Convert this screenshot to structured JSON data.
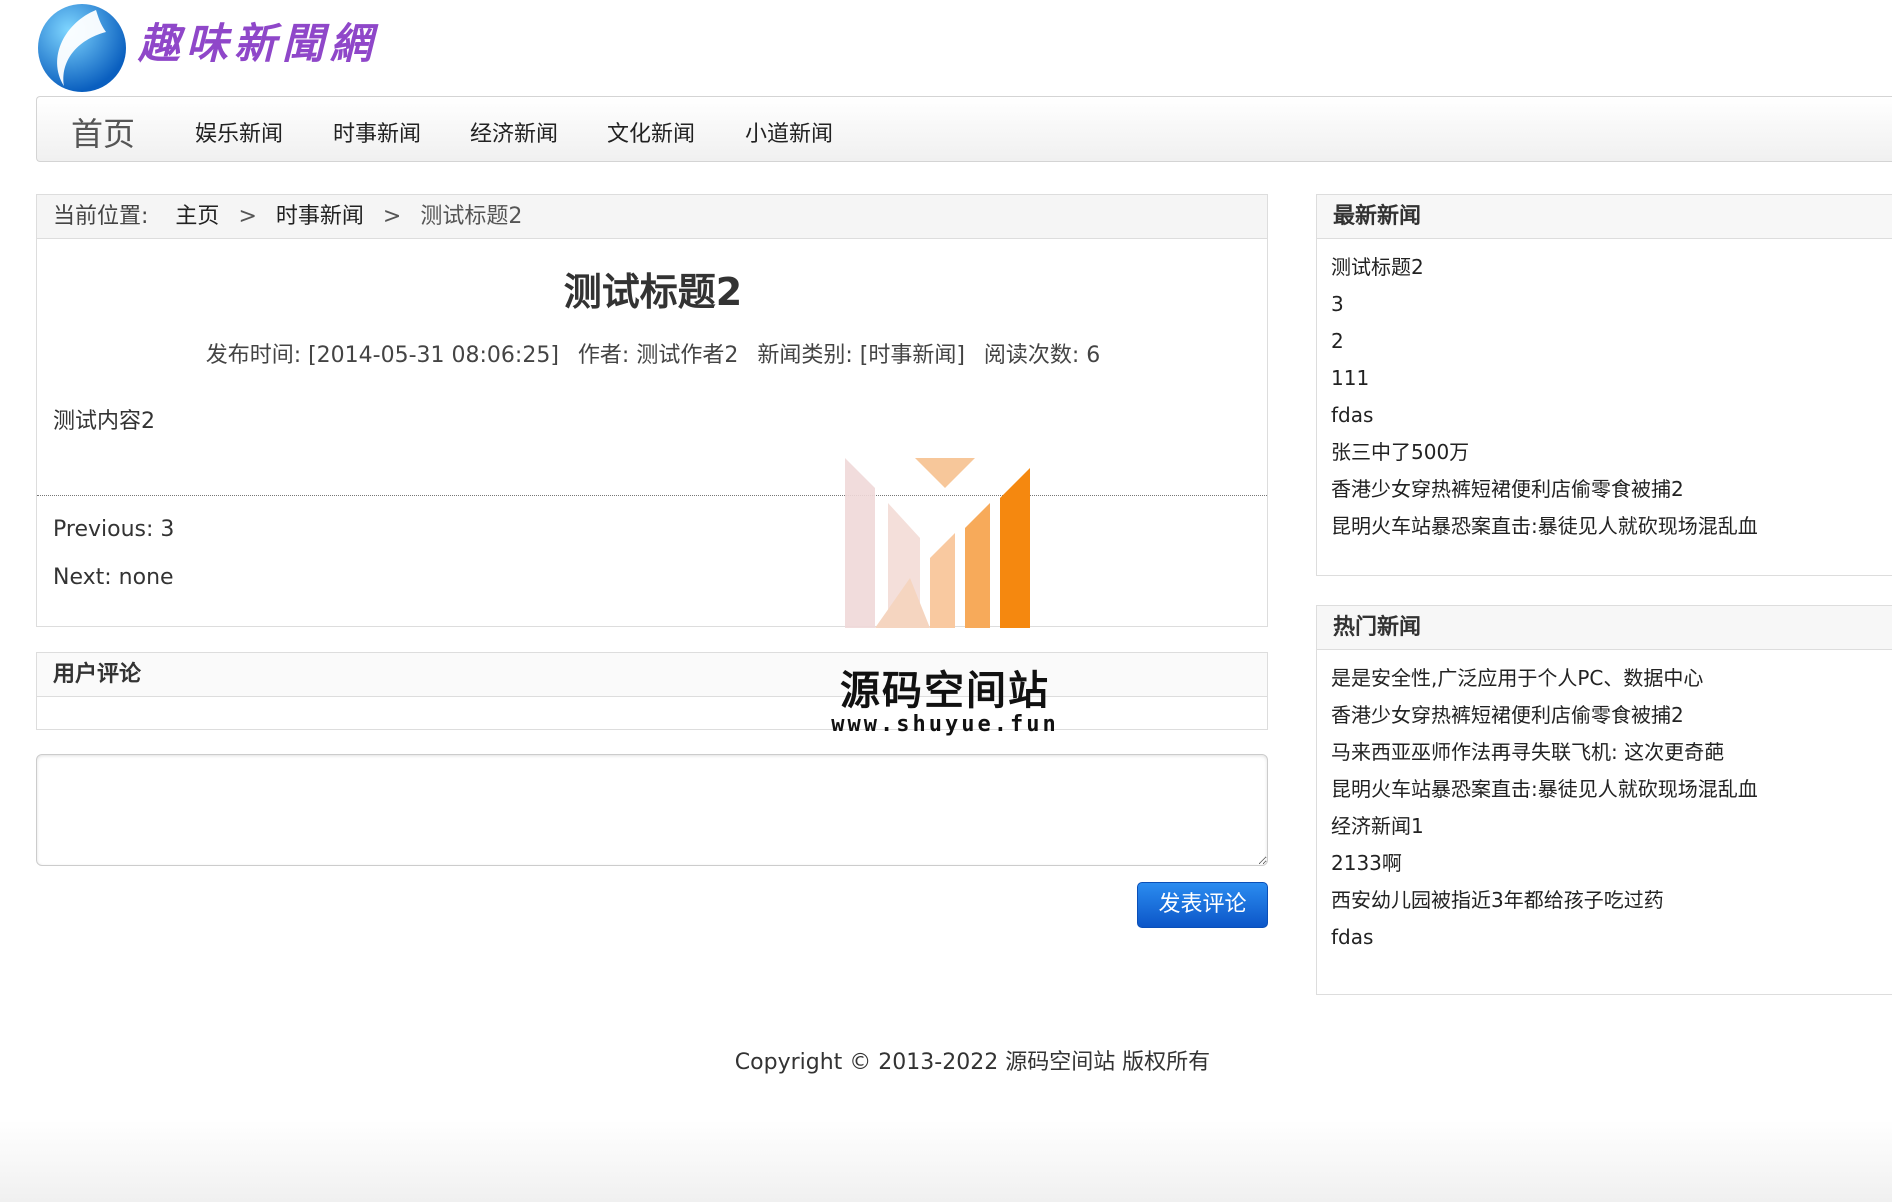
{
  "header": {
    "site_name": "趣味新聞網"
  },
  "nav": {
    "home": "首页",
    "items": [
      {
        "label": "娱乐新闻"
      },
      {
        "label": "时事新闻"
      },
      {
        "label": "经济新闻"
      },
      {
        "label": "文化新闻"
      },
      {
        "label": "小道新闻"
      }
    ]
  },
  "breadcrumb": {
    "label": "当前位置:",
    "home": "主页",
    "sep": ">",
    "category": "时事新闻",
    "current": "测试标题2"
  },
  "article": {
    "title": "测试标题2",
    "publish_time": "发布时间: [2014-05-31 08:06:25]",
    "author": "作者: 测试作者2",
    "category": "新闻类别: [时事新闻]",
    "views": "阅读次数: 6",
    "content": "测试内容2",
    "prev_label": "Previous:",
    "prev_value": "3",
    "next_label": "Next:",
    "next_value": "none"
  },
  "comments": {
    "title": "用户评论",
    "input_value": "",
    "submit_label": "发表评论"
  },
  "latest_news": {
    "title": "最新新闻",
    "items": [
      "测试标题2",
      "3",
      "2",
      "111",
      "fdas",
      "张三中了500万",
      "香港少女穿热裤短裙便利店偷零食被捕2",
      "昆明火车站暴恐案直击:暴徒见人就砍现场混乱血"
    ]
  },
  "hot_news": {
    "title": "热门新闻",
    "items": [
      "是是安全性,广泛应用于个人PC、数据中心",
      "香港少女穿热裤短裙便利店偷零食被捕2",
      "马来西亚巫师作法再寻失联飞机: 这次更奇葩",
      "昆明火车站暴恐案直击:暴徒见人就砍现场混乱血",
      "经济新闻1",
      "2133啊",
      "西安幼儿园被指近3年都给孩子吃过药",
      "fdas"
    ]
  },
  "footer": {
    "copyright": "Copyright © 2013-2022 源码空间站 版权所有"
  },
  "watermark": {
    "title": "源码空间站",
    "url": "www.shuyue.fun"
  },
  "colors": {
    "accent_button": "#1a6fe0",
    "site_name": "#8f47c9",
    "watermark_orange": "#f5880f"
  }
}
